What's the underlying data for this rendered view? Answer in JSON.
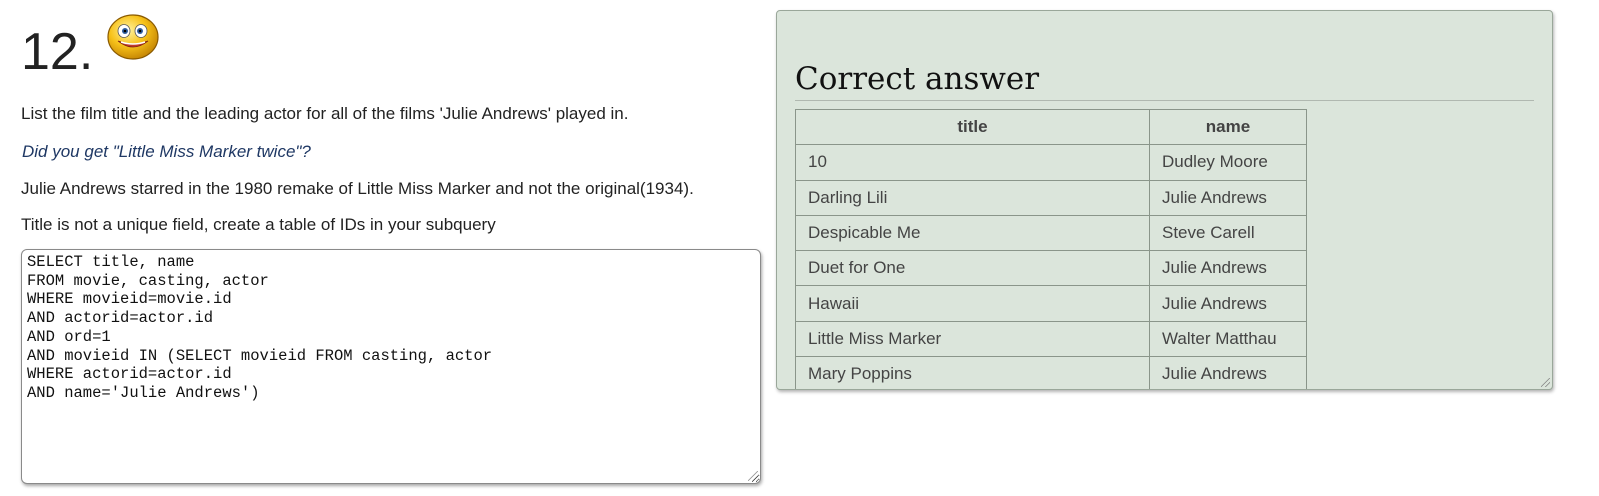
{
  "question": {
    "number": "12.",
    "icon": "smiley-face-icon",
    "prompt": "List the film title and the leading actor for all of the films 'Julie Andrews' played in.",
    "hint": "Did you get \"Little Miss Marker twice\"?",
    "note1": "Julie Andrews starred in the 1980 remake of Little Miss Marker and not the original(1934).",
    "note2": "Title is not a unique field, create a table of IDs in your subquery"
  },
  "editor": {
    "lines": [
      "SELECT title, name",
      "FROM movie, casting, actor",
      "WHERE movieid=movie.id",
      "AND actorid=actor.id",
      "AND ord=1",
      "AND movieid IN (SELECT movieid FROM casting, actor",
      "WHERE actorid=actor.id",
      "AND name='Julie Andrews')"
    ]
  },
  "answer": {
    "heading": "Correct answer",
    "columns": [
      "title",
      "name"
    ],
    "rows": [
      [
        "10",
        "Dudley Moore"
      ],
      [
        "Darling Lili",
        "Julie Andrews"
      ],
      [
        "Despicable Me",
        "Steve Carell"
      ],
      [
        "Duet for One",
        "Julie Andrews"
      ],
      [
        "Hawaii",
        "Julie Andrews"
      ],
      [
        "Little Miss Marker",
        "Walter Matthau"
      ],
      [
        "Mary Poppins",
        "Julie Andrews"
      ]
    ]
  },
  "colors": {
    "answer_bg": "#dbe5db",
    "hint_text": "#1f3864"
  }
}
